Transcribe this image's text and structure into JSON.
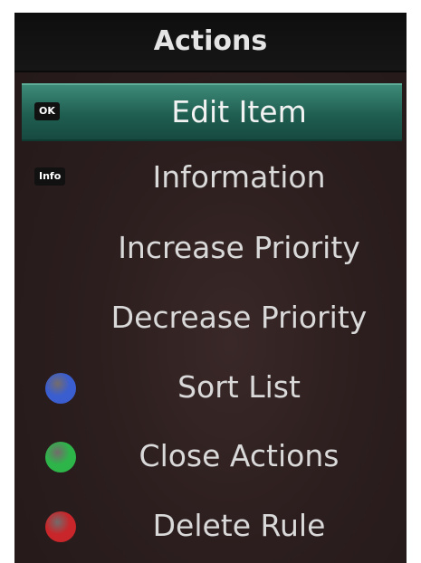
{
  "header": {
    "title": "Actions"
  },
  "menu": {
    "items": [
      {
        "label": "Edit Item",
        "badge": "OK"
      },
      {
        "label": "Information",
        "badge": "Info"
      },
      {
        "label": "Increase Priority"
      },
      {
        "label": "Decrease Priority"
      },
      {
        "label": "Sort List",
        "dot": "blue",
        "dot_color": "#3a5ed0"
      },
      {
        "label": "Close Actions",
        "dot": "green",
        "dot_color": "#2db54a"
      },
      {
        "label": "Delete Rule",
        "dot": "red",
        "dot_color": "#c8262a"
      }
    ],
    "selected_index": 0
  }
}
